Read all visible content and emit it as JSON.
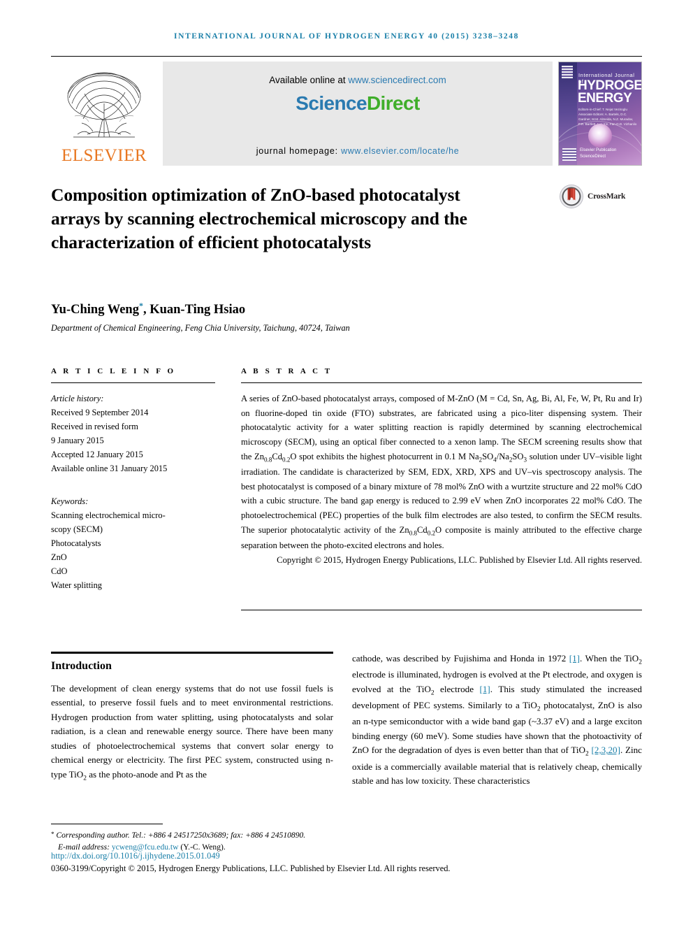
{
  "running_head": "INTERNATIONAL JOURNAL OF HYDROGEN ENERGY 40 (2015) 3238–3248",
  "header": {
    "publisher": "ELSEVIER",
    "available_prefix": "Available online at ",
    "available_url": "www.sciencedirect.com",
    "sciencedirect_sci": "Science",
    "sciencedirect_dir": "Direct",
    "homepage_label": "journal homepage: ",
    "homepage_url": "www.elsevier.com/locate/he",
    "cover": {
      "subtitle": "International Journal of",
      "line1": "HYDROGEN",
      "line2": "ENERGY",
      "editors": "Editors-in-Chief: T. Nejat Veziroglu\nAssociate Editors: A. Bartels, D.C. Gardner, M.M. Almeida, N.Z. Muradov, P.R. Bartlett, Luo Xin, Fan O.D. Vizhanlio",
      "brand": "Elsevier Publication\nScienceDirect"
    }
  },
  "article": {
    "title": "Composition optimization of ZnO-based photocatalyst arrays by scanning electrochemical microscopy and the characterization of efficient photocatalysts",
    "crossmark_label": "CrossMark",
    "authors": "Yu-Ching Weng",
    "authors_suffix": ", Kuan-Ting Hsiao",
    "corresponding_marker": "*",
    "affiliation": "Department of Chemical Engineering, Feng Chia University, Taichung, 40724, Taiwan"
  },
  "article_info": {
    "heading": "A R T I C L E  I N F O",
    "history_label": "Article history:",
    "history": [
      "Received 9 September 2014",
      "Received in revised form",
      "9 January 2015",
      "Accepted 12 January 2015",
      "Available online 31 January 2015"
    ],
    "keywords_label": "Keywords:",
    "keywords": [
      "Scanning electrochemical micro-",
      "scopy (SECM)",
      "Photocatalysts",
      "ZnO",
      "CdO",
      "Water splitting"
    ]
  },
  "abstract": {
    "heading": "A B S T R A C T",
    "part1": "A series of ZnO-based photocatalyst arrays, composed of M-ZnO (M = Cd, Sn, Ag, Bi, Al, Fe, W, Pt, Ru and Ir) on fluorine-doped tin oxide (FTO) substrates, are fabricated using a pico-liter dispensing system. Their photocatalytic activity for a water splitting reaction is rapidly determined by scanning electrochemical microscopy (SECM), using an optical fiber connected to a xenon lamp. The SECM screening results show that the Zn",
    "f1_sub1": "0.8",
    "f1_mid": "Cd",
    "f1_sub2": "0.2",
    "f1_tail": "O spot exhibits the highest photocurrent in 0.1 M Na",
    "na_sub1": "2",
    "na_mid1": "SO",
    "na_sub2": "4",
    "na_mid2": "/Na",
    "na_sub3": "2",
    "na_mid3": "SO",
    "na_sub4": "3",
    "part2": " solution under UV–visible light irradiation. The candidate is characterized by SEM, EDX, XRD, XPS and UV–vis spectroscopy analysis. The best photocatalyst is composed of a binary mixture of 78 mol% ZnO with a wurtzite structure and 22 mol% CdO with a cubic structure. The band gap energy is reduced to 2.99 eV when ZnO incorporates 22 mol% CdO. The photoelectrochemical (PEC) properties of the bulk film electrodes are also tested, to confirm the SECM results. The superior photocatalytic activity of the Zn",
    "f2_sub1": "0.8",
    "f2_mid": "Cd",
    "f2_sub2": "0.2",
    "part3": "O composite is mainly attributed to the effective charge separation between the photo-excited electrons and holes.",
    "copyright": "Copyright © 2015, Hydrogen Energy Publications, LLC. Published by Elsevier Ltd. All rights reserved."
  },
  "introduction": {
    "heading": "Introduction",
    "left_p1": "The development of clean energy systems that do not use fossil fuels is essential, to preserve fossil fuels and to meet environmental restrictions. Hydrogen production from water splitting, using photocatalysts and solar radiation, is a clean and renewable energy source. There have been many studies of photoelectrochemical systems that convert solar energy to chemical energy or electricity. The first PEC system, constructed using n-type TiO",
    "left_sub": "2",
    "left_p1b": " as the photo-anode and Pt as the",
    "right_a": "cathode, was described by Fujishima and Honda in 1972 ",
    "right_ref1": "[1]",
    "right_b": ". When the TiO",
    "right_sub1": "2",
    "right_c": " electrode is illuminated, hydrogen is evolved at the Pt electrode, and oxygen is evolved at the TiO",
    "right_sub2": "2",
    "right_d": " electrode ",
    "right_ref2": "[1]",
    "right_e": ". This study stimulated the increased development of PEC systems. Similarly to a TiO",
    "right_sub3": "2",
    "right_f": " photocatalyst, ZnO is also an n-type semiconductor with a wide band gap (~3.37 eV) and a large exciton binding energy (60 meV). Some studies have shown that the photoactivity of ZnO for the degradation of dyes is even better than that of TiO",
    "right_sub4": "2",
    "right_g": " ",
    "right_ref3": "[2,3,20]",
    "right_h": ". Zinc oxide is a commercially available material that is relatively cheap, chemically stable and has low toxicity. These characteristics"
  },
  "footer": {
    "corresponding": "Corresponding author. Tel.: +886 4 24517250x3689; fax: +886 4 24510890.",
    "email_label": "E-mail address: ",
    "email": "ycweng@fcu.edu.tw",
    "email_suffix": " (Y.-C. Weng).",
    "doi": "http://dx.doi.org/10.1016/j.ijhydene.2015.01.049",
    "issn_line": "0360-3199/Copyright © 2015, Hydrogen Energy Publications, LLC. Published by Elsevier Ltd. All rights reserved."
  },
  "colors": {
    "link": "#1a7fa8",
    "elsevier_orange": "#e87722",
    "sciencedirect_blue": "#2a7ab0",
    "sciencedirect_green": "#3fae2a"
  }
}
